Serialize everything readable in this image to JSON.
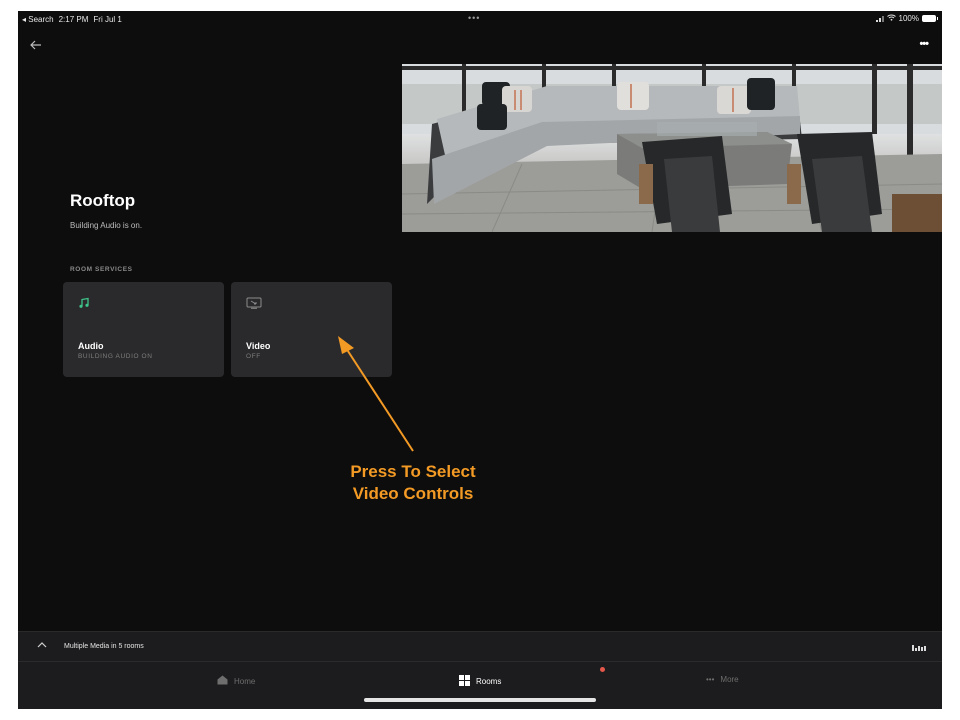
{
  "status_bar": {
    "back_app": "◂ Search",
    "time": "2:17 PM",
    "date": "Fri Jul 1",
    "center_dots": "•••",
    "battery": "100%"
  },
  "room": {
    "title": "Rooftop",
    "subtitle": "Building Audio is on.",
    "section_label": "ROOM SERVICES"
  },
  "services": [
    {
      "title": "Audio",
      "status": "BUILDING AUDIO ON",
      "icon": "music-note-icon",
      "icon_color": "#3ec38a"
    },
    {
      "title": "Video",
      "status": "OFF",
      "icon": "screen-cast-icon"
    }
  ],
  "annotation": {
    "line1": "Press To Select",
    "line2": "Video Controls",
    "color": "#f39a25"
  },
  "mini_player": {
    "text": "Multiple Media in 5 rooms"
  },
  "tabs": [
    {
      "label": "Home",
      "icon": "home-icon"
    },
    {
      "label": "Rooms",
      "icon": "grid-icon",
      "active": true
    },
    {
      "label": "More",
      "icon": "dots-icon"
    }
  ]
}
